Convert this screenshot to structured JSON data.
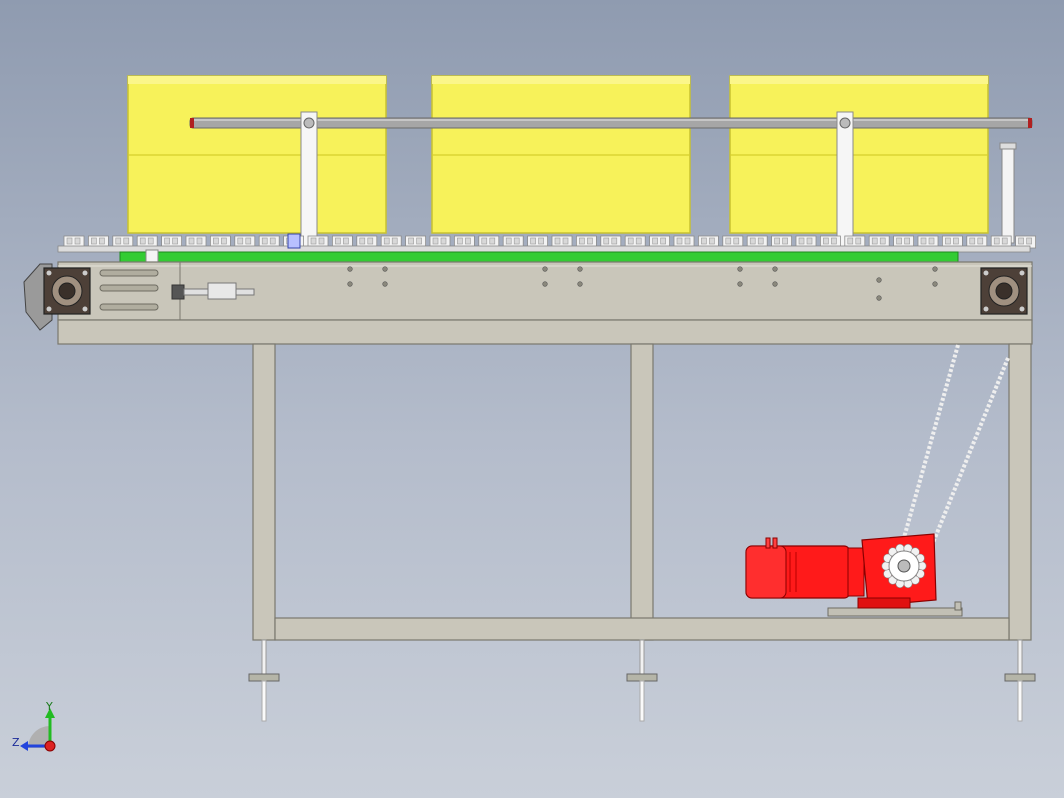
{
  "viewport": {
    "background_top": "#8f9bb0",
    "background_bottom": "#c9cfd9"
  },
  "triad": {
    "x_label": "",
    "y_label": "Y",
    "z_label": "Z",
    "y_color": "#22bb22",
    "z_color": "#2244dd",
    "origin_color": "#dd2222"
  },
  "colors": {
    "box": "#f7f25a",
    "frame": "#c9c6ba",
    "frame_stroke": "#7a786e",
    "belt": "#33cc33",
    "motor": "#ff1a1a",
    "rail": "#9a9a9a",
    "bearing": "#5a4a40",
    "chain": "#e8e8e8"
  }
}
